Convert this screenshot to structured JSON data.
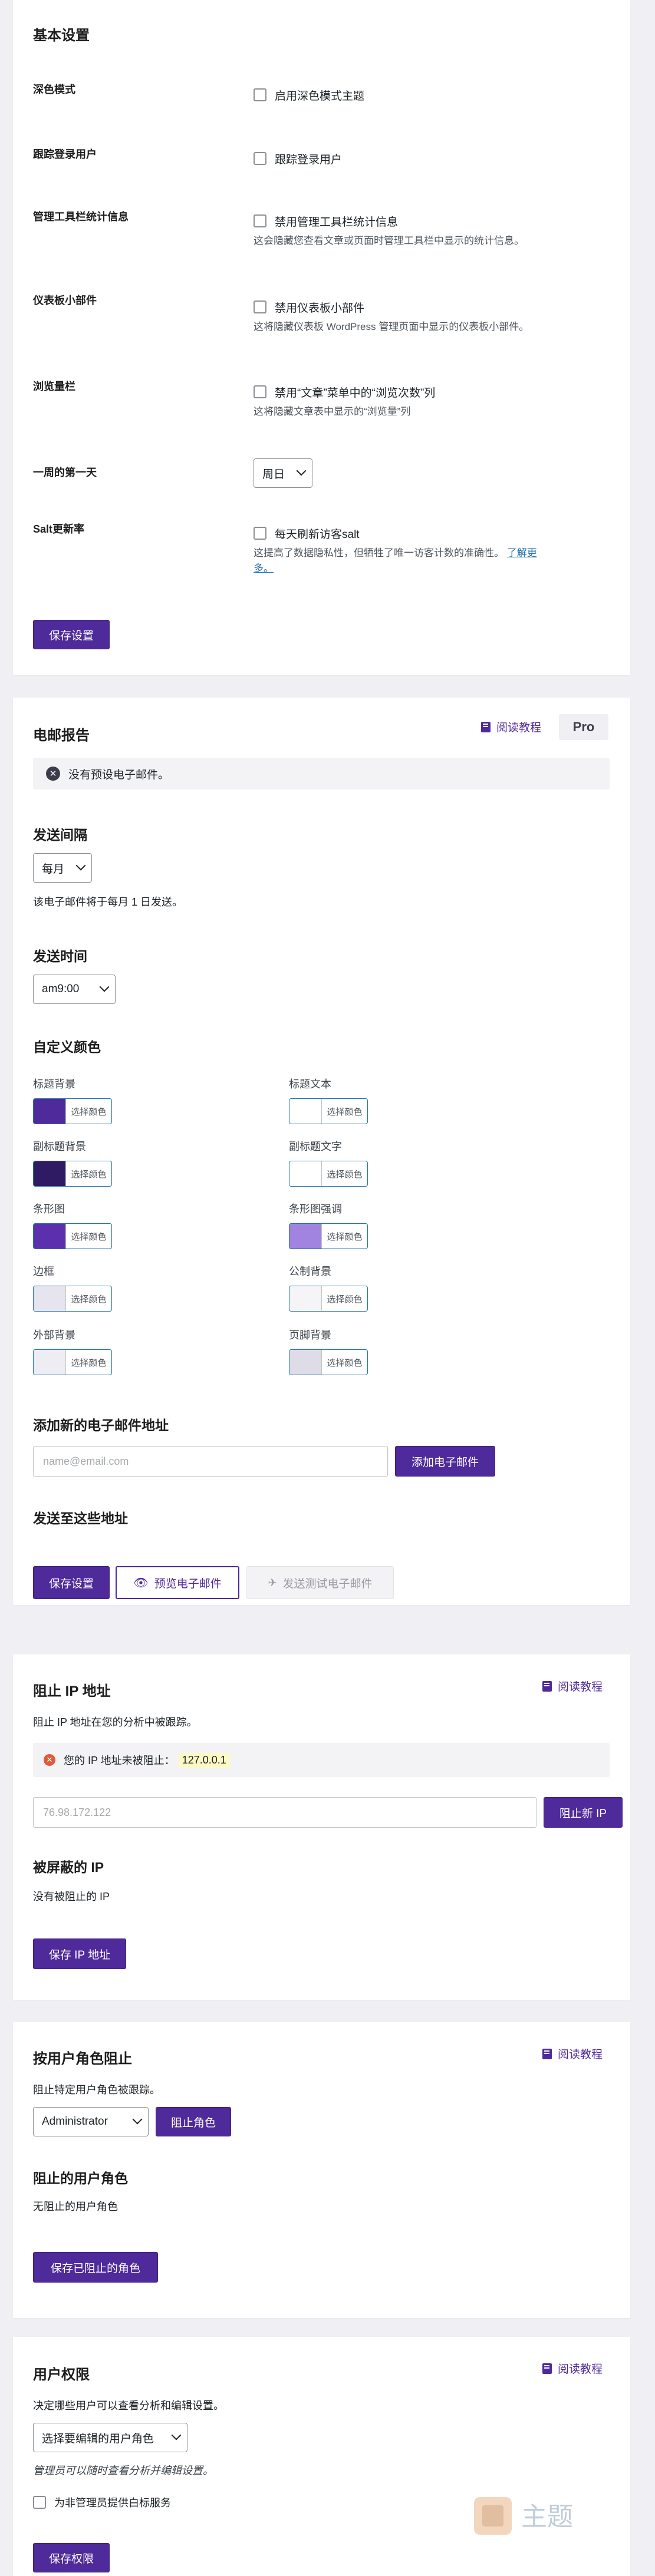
{
  "basic": {
    "title": "基本设置",
    "rows": [
      {
        "label": "深色模式",
        "check": "启用深色模式主题",
        "desc": ""
      },
      {
        "label": "跟踪登录用户",
        "check": "跟踪登录用户",
        "desc": ""
      },
      {
        "label": "管理工具栏统计信息",
        "check": "禁用管理工具栏统计信息",
        "desc": "这会隐藏您查看文章或页面时管理工具栏中显示的统计信息。"
      },
      {
        "label": "仪表板小部件",
        "check": "禁用仪表板小部件",
        "desc": "这将隐藏仪表板 WordPress 管理页面中显示的仪表板小部件。"
      },
      {
        "label": "浏览量栏",
        "check": "禁用“文章”菜单中的“浏览次数”列",
        "desc": "这将隐藏文章表中显示的“浏览量”列"
      }
    ],
    "week_label": "一周的第一天",
    "week_value": "周日",
    "salt_label": "Salt更新率",
    "salt_check": "每天刷新访客salt",
    "salt_desc_1": "这提高了数据隐私性，但牺牲了唯一访客计数的准确性。",
    "salt_link_1": "了解更",
    "salt_link_2": "多。",
    "save": "保存设置"
  },
  "email": {
    "title": "电邮报告",
    "read": "阅读教程",
    "pro": "Pro",
    "notice": "没有预设电子邮件。",
    "interval_title": "发送间隔",
    "interval_value": "每月",
    "interval_desc": "该电子邮件将于每月 1 日发送。",
    "time_title": "发送时间",
    "time_value": "am9:00",
    "colors_title": "自定义颜色",
    "picker_text": "选择颜色",
    "colors": [
      {
        "name": "标题背景",
        "color": "#4f2a9a"
      },
      {
        "name": "标题文本",
        "color": "#ffffff"
      },
      {
        "name": "副标题背景",
        "color": "#2e1b63"
      },
      {
        "name": "副标题文字",
        "color": "#ffffff"
      },
      {
        "name": "条形图",
        "color": "#5b2fae"
      },
      {
        "name": "条形图强调",
        "color": "#a184e0"
      },
      {
        "name": "边框",
        "color": "#e6e4ee"
      },
      {
        "name": "公制背景",
        "color": "#f5f5f8"
      },
      {
        "name": "外部背景",
        "color": "#eeedf3"
      },
      {
        "name": "页脚背景",
        "color": "#dedce6"
      }
    ],
    "add_title": "添加新的电子邮件地址",
    "add_placeholder": "name@email.com",
    "add_button": "添加电子邮件",
    "send_to_title": "发送至这些地址",
    "save": "保存设置",
    "preview": "预览电子邮件",
    "send_test": "发送测试电子邮件"
  },
  "ip": {
    "title": "阻止 IP 地址",
    "read": "阅读教程",
    "desc": "阻止 IP 地址在您的分析中被跟踪。",
    "notice": "您的 IP 地址未被阻止：",
    "ip_value": "127.0.0.1",
    "placeholder": "76.98.172.122",
    "block_button": "阻止新 IP",
    "blocked_title": "被屏蔽的 IP",
    "blocked_empty": "没有被阻止的 IP",
    "save": "保存 IP 地址"
  },
  "role": {
    "title": "按用户角色阻止",
    "read": "阅读教程",
    "desc": "阻止特定用户角色被跟踪。",
    "select_value": "Administrator",
    "block_button": "阻止角色",
    "blocked_title": "阻止的用户角色",
    "blocked_empty": "无阻止的用户角色",
    "save": "保存已阻止的角色"
  },
  "perm": {
    "title": "用户权限",
    "read": "阅读教程",
    "desc": "决定哪些用户可以查看分析和编辑设置。",
    "select_value": "选择要编辑的用户角色",
    "note": "管理员可以随时查看分析并编辑设置。",
    "check": "为非管理员提供白标服务",
    "save": "保存权限"
  },
  "watermark": "主题"
}
